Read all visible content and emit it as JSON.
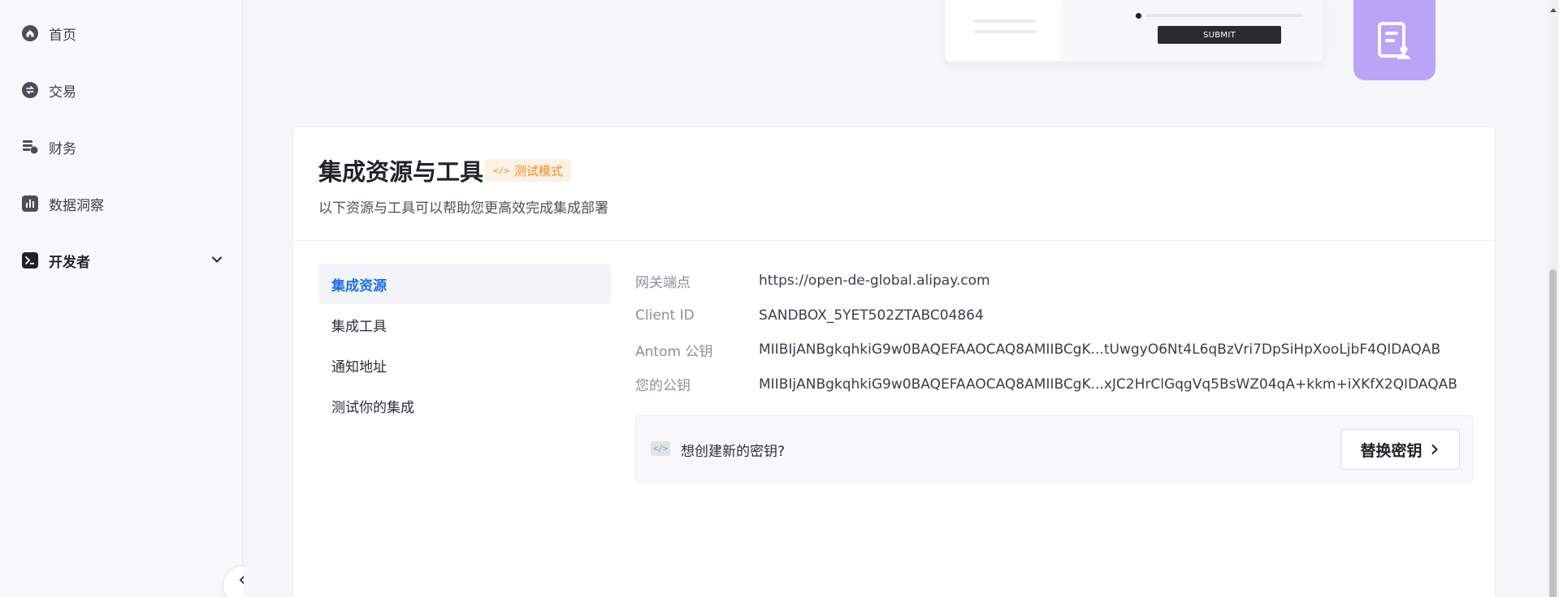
{
  "sidebar": {
    "items": [
      {
        "label": "首页",
        "icon": "home-icon"
      },
      {
        "label": "交易",
        "icon": "exchange-icon"
      },
      {
        "label": "财务",
        "icon": "finance-icon"
      },
      {
        "label": "数据洞察",
        "icon": "chart-icon"
      },
      {
        "label": "开发者",
        "icon": "terminal-icon"
      }
    ]
  },
  "illustration": {
    "submit_label": "SUBMIT"
  },
  "section": {
    "title": "集成资源与工具",
    "badge": "测试模式",
    "badge_icon": "</>",
    "subtitle": "以下资源与工具可以帮助您更高效完成集成部署"
  },
  "menu": {
    "items": [
      "集成资源",
      "集成工具",
      "通知地址",
      "测试你的集成"
    ]
  },
  "details": {
    "rows": [
      {
        "key": "网关端点",
        "value": "https://open-de-global.alipay.com"
      },
      {
        "key": "Client ID",
        "value": "SANDBOX_5YET502ZTABC04864"
      },
      {
        "key": "Antom 公钥",
        "value": "MIIBIjANBgkqhkiG9w0BAQEFAAOCAQ8AMIIBCgK...tUwgyO6Nt4L6qBzVri7DpSiHpXooLjbF4QIDAQAB"
      },
      {
        "key": "您的公钥",
        "value": "MIIBIjANBgkqhkiG9w0BAQEFAAOCAQ8AMIIBCgK...xJC2HrClGqgVq5BsWZ04qA+kkm+iXKfX2QIDAQAB"
      }
    ]
  },
  "key_panel": {
    "icon": "</>",
    "text": "想创建新的密钥?",
    "button": "替换密钥"
  },
  "colors": {
    "accent": "#1f6fe6",
    "badge_text": "#f08a2b",
    "badge_bg": "#fff1e4",
    "illustration_purple": "#b9a4f8"
  }
}
